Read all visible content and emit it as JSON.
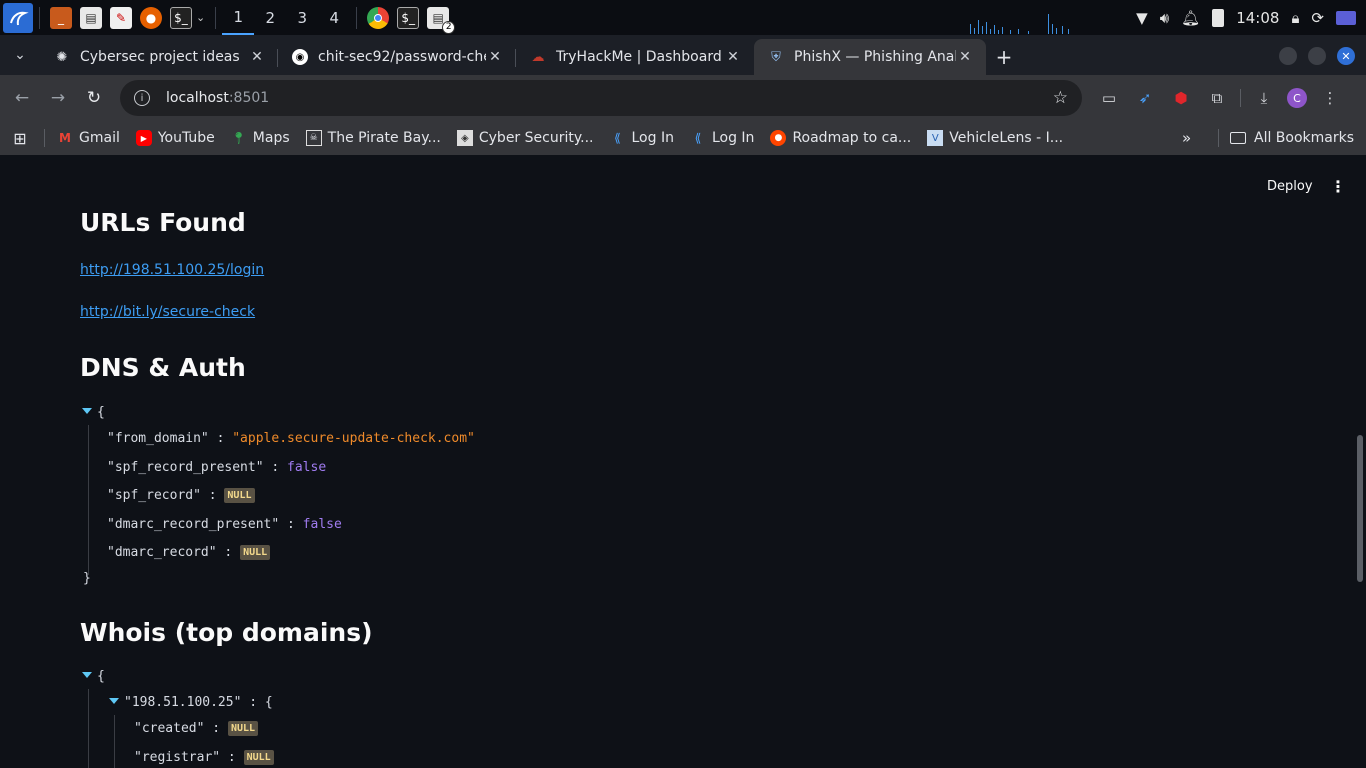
{
  "taskbar": {
    "workspaces": [
      "1",
      "2",
      "3",
      "4"
    ],
    "clock": "14:08",
    "folder_badge": "2"
  },
  "tabs": [
    {
      "title": "Cybersec project ideas",
      "favicon": "openai-icon"
    },
    {
      "title": "chit-sec92/password-che",
      "favicon": "github-icon"
    },
    {
      "title": "TryHackMe | Dashboard",
      "favicon": "tryhackme-icon"
    },
    {
      "title": "PhishX — Phishing Analy",
      "favicon": "shield-icon",
      "active": true
    }
  ],
  "toolbar": {
    "url_host": "localhost",
    "url_port": ":8501",
    "avatar_letter": "C"
  },
  "bookmarks": [
    {
      "label": "Gmail",
      "icon": "gmail-icon"
    },
    {
      "label": "YouTube",
      "icon": "youtube-icon"
    },
    {
      "label": "Maps",
      "icon": "maps-icon"
    },
    {
      "label": "The Pirate Bay...",
      "icon": "piratebay-icon"
    },
    {
      "label": "Cyber Security...",
      "icon": "cybersec-icon"
    },
    {
      "label": "Log In",
      "icon": "login-icon"
    },
    {
      "label": "Log In",
      "icon": "login-icon"
    },
    {
      "label": "Roadmap to ca...",
      "icon": "reddit-icon"
    },
    {
      "label": "VehicleLens - I...",
      "icon": "vehiclelens-icon"
    }
  ],
  "bookmarks_all": "All Bookmarks",
  "app": {
    "deploy_label": "Deploy",
    "urls_heading": "URLs Found",
    "urls": [
      "http://198.51.100.25/login",
      "http://bit.ly/secure-check"
    ],
    "dns_heading": "DNS & Auth",
    "dns": {
      "open": "{",
      "close": "}",
      "from_domain_key": "\"from_domain\"",
      "from_domain_val": "\"apple.secure-update-check.com\"",
      "spf_present_key": "\"spf_record_present\"",
      "spf_present_val": "false",
      "spf_record_key": "\"spf_record\"",
      "dmarc_present_key": "\"dmarc_record_present\"",
      "dmarc_present_val": "false",
      "dmarc_record_key": "\"dmarc_record\"",
      "null_label": "NULL"
    },
    "whois_heading": "Whois (top domains)",
    "whois": {
      "open": "{",
      "domain_key": "\"198.51.100.25\"",
      "domain_open": "{",
      "created_key": "\"created\"",
      "registrar_key": "\"registrar\"",
      "null_label": "NULL"
    },
    "colon": ":"
  }
}
